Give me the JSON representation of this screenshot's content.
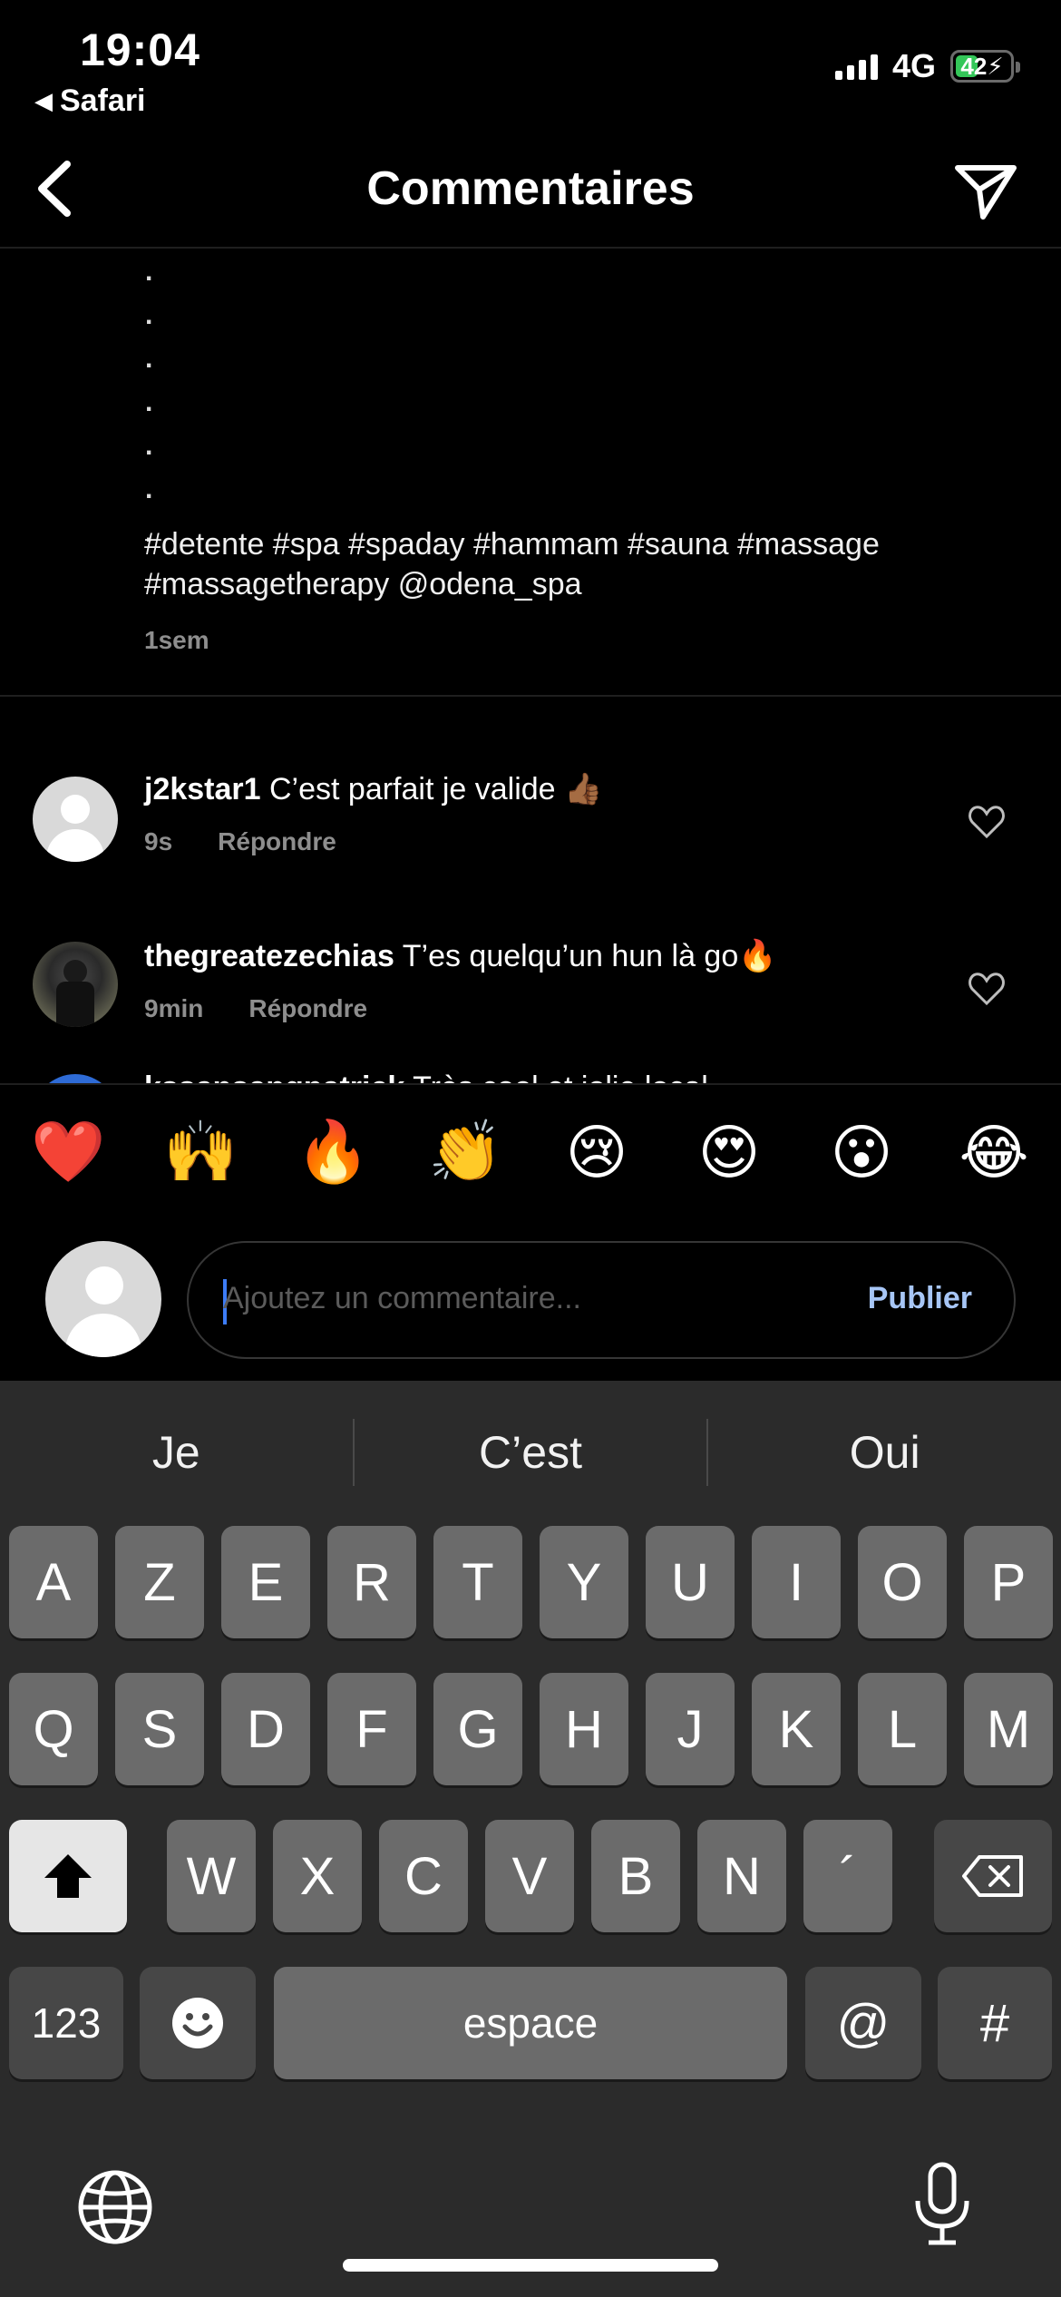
{
  "status_bar": {
    "time": "19:04",
    "back_app_label": "Safari",
    "network": "4G",
    "battery_level": "42",
    "battery_fraction": 0.42
  },
  "header": {
    "title": "Commentaires"
  },
  "caption": {
    "dots": [
      ".",
      ".",
      ".",
      ".",
      ".",
      ".",
      "."
    ],
    "hashtags": "#detente #spa #spaday #hammam #sauna #massage #massagetherapy @odena_spa",
    "time": "1sem"
  },
  "comments": [
    {
      "username": "j2kstar1",
      "text": "C’est parfait je valide 👍🏾",
      "time": "9s",
      "reply_label": "Répondre"
    },
    {
      "username": "thegreatezechias",
      "text": "T’es quelqu’un hun là go🔥",
      "time": "9min",
      "reply_label": "Répondre"
    },
    {
      "username": "kssansangpatrick",
      "text": "Très cool et jolie local"
    }
  ],
  "emoji_bar": [
    "❤️",
    "🙌",
    "🔥",
    "👏",
    "😢",
    "😍",
    "😮",
    "😂"
  ],
  "comment_input": {
    "placeholder": "Ajoutez un commentaire...",
    "publish_label": "Publier"
  },
  "keyboard": {
    "suggestions": [
      "Je",
      "C’est",
      "Oui"
    ],
    "row1": [
      "A",
      "Z",
      "E",
      "R",
      "T",
      "Y",
      "U",
      "I",
      "O",
      "P"
    ],
    "row2": [
      "Q",
      "S",
      "D",
      "F",
      "G",
      "H",
      "J",
      "K",
      "L",
      "M"
    ],
    "row3": [
      "W",
      "X",
      "C",
      "V",
      "B",
      "N",
      "´"
    ],
    "numbers_label": "123",
    "space_label": "espace",
    "at_label": "@",
    "hash_label": "#"
  }
}
